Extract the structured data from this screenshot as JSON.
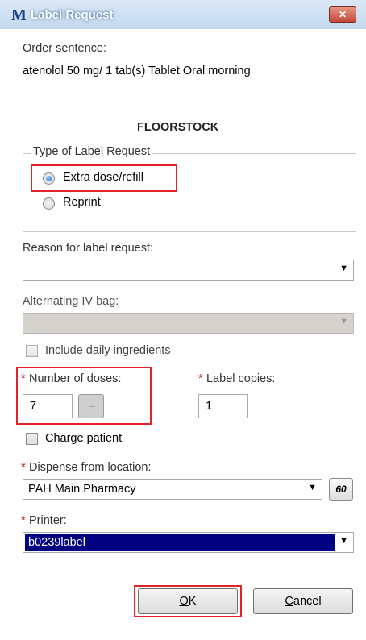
{
  "window": {
    "icon_letter": "M",
    "title": "Label Request",
    "close_glyph": "✕"
  },
  "order": {
    "label": "Order sentence:",
    "value": "atenolol 50 mg/ 1 tab(s) Tablet Oral morning"
  },
  "section_title": "FLOORSTOCK",
  "label_type": {
    "legend": "Type of Label Request",
    "options": [
      {
        "label": "Extra dose/refill",
        "checked": true
      },
      {
        "label": "Reprint",
        "checked": false
      }
    ]
  },
  "reason": {
    "label": "Reason for label request:",
    "value": ""
  },
  "alt_iv": {
    "label": "Alternating IV bag:",
    "value": "",
    "disabled": true
  },
  "include_daily": {
    "label": "Include daily ingredients",
    "checked": false,
    "disabled": true
  },
  "doses": {
    "required_mark": "*",
    "label": "Number of doses:",
    "value": "7",
    "ellipsis": "..."
  },
  "copies": {
    "required_mark": "*",
    "label": "Label copies:",
    "value": "1"
  },
  "charge": {
    "label": "Charge patient",
    "checked": false
  },
  "dispense": {
    "required_mark": "*",
    "label": "Dispense from location:",
    "value": "PAH Main Pharmacy",
    "lookup_glyph": "60"
  },
  "printer": {
    "required_mark": "*",
    "label": "Printer:",
    "value": "b0239label"
  },
  "buttons": {
    "ok": "OK",
    "cancel": "Cancel"
  },
  "icons": {
    "dropdown": "chevron-down-icon",
    "lookup": "binoculars-icon",
    "close": "close-icon"
  },
  "colors": {
    "highlight": "#e0242a",
    "selection": "#000080",
    "required": "#d01010"
  }
}
